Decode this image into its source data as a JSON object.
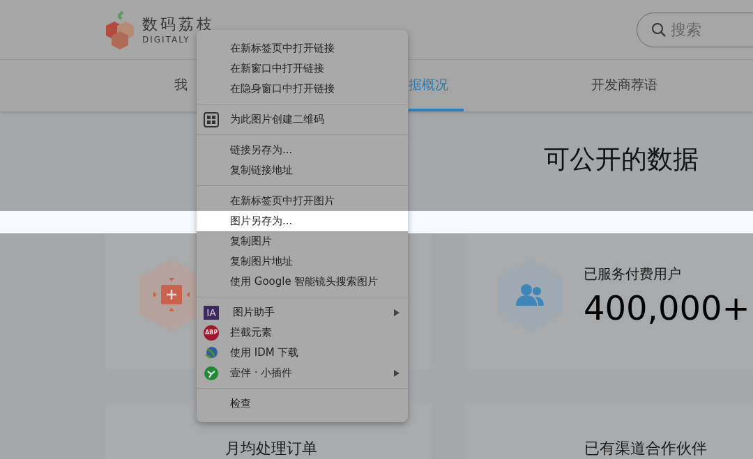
{
  "header": {
    "logo": {
      "name": "数码荔枝",
      "subtitle": "DIGITALY"
    },
    "search": {
      "placeholder": "搜索"
    }
  },
  "nav": {
    "tabs": [
      {
        "label": "我",
        "selected": false
      },
      {
        "label": "据概况",
        "selected": true
      },
      {
        "label": "开发商荐语",
        "selected": false
      }
    ]
  },
  "content": {
    "title": "可公开的数据",
    "cards": [
      {
        "kind": "expand"
      },
      {
        "kind": "users",
        "title": "已服务付费用户",
        "value": "400,000+"
      },
      {
        "kind": "orders",
        "title": "月均处理订单"
      },
      {
        "kind": "partners",
        "title": "已有渠道合作伙伴"
      }
    ]
  },
  "context_menu": {
    "sections": [
      {
        "items": [
          {
            "label": "在新标签页中打开链接",
            "selected": false
          },
          {
            "label": "在新窗口中打开链接",
            "selected": false
          },
          {
            "label": "在隐身窗口中打开链接",
            "selected": false
          }
        ]
      },
      {
        "items": [
          {
            "label": "为此图片创建二维码",
            "kind": "qr",
            "selected": false
          }
        ]
      },
      {
        "items": [
          {
            "label": "链接另存为...",
            "selected": false
          },
          {
            "label": "复制链接地址",
            "selected": false
          }
        ]
      },
      {
        "items": [
          {
            "label": "在新标签页中打开图片",
            "selected": false
          },
          {
            "label": "图片另存为...",
            "selected": true
          },
          {
            "label": "复制图片",
            "selected": false
          },
          {
            "label": "复制图片地址",
            "selected": false
          },
          {
            "label": "使用 Google 智能镜头搜索图片",
            "selected": false
          }
        ]
      },
      {
        "items": [
          {
            "label": "图片助手",
            "kind": "ia",
            "badge": "IA",
            "submenu": true,
            "selected": false
          },
          {
            "label": "拦截元素",
            "kind": "abp",
            "badge": "ABP",
            "selected": false
          },
          {
            "label": "使用 IDM 下载",
            "kind": "idm",
            "selected": false
          },
          {
            "label": "壹伴 · 小插件",
            "kind": "yiban",
            "submenu": true,
            "selected": false
          }
        ]
      },
      {
        "items": [
          {
            "label": "检查",
            "selected": false
          }
        ]
      }
    ]
  }
}
